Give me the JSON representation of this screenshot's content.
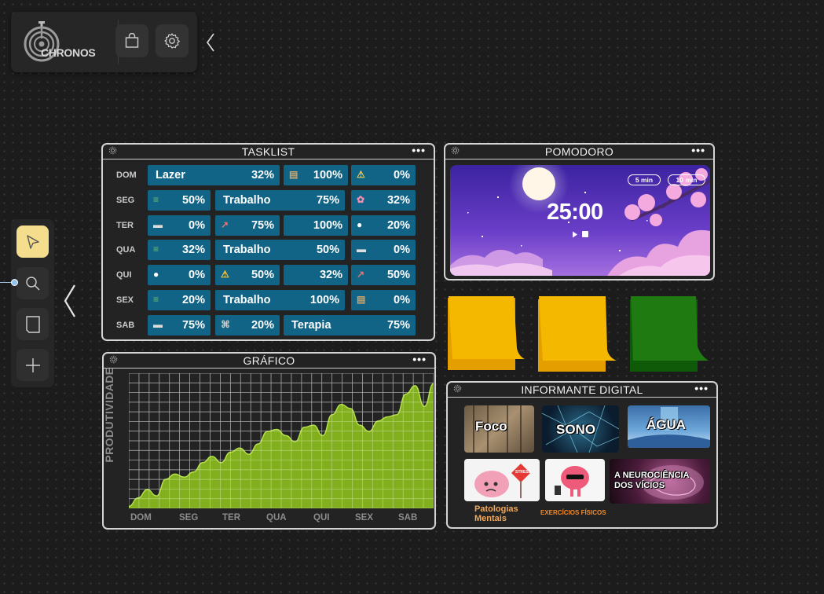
{
  "toolbar": {
    "logo_text": "CHRONOS",
    "shop_icon": "shopping-bag-icon",
    "settings_icon": "gear-icon",
    "collapse_icon": "chevron-left-icon"
  },
  "rail": {
    "tools": [
      "select-arrow-icon",
      "search-icon",
      "note-icon",
      "plus-icon"
    ],
    "collapse_icon": "chevron-left-icon"
  },
  "tasklist": {
    "title": "TASKLIST",
    "menu": "•••",
    "days": [
      "DOM",
      "SEG",
      "TER",
      "QUA",
      "QUI",
      "SEX",
      "SAB"
    ],
    "rows": [
      [
        {
          "label": "Lazer",
          "pct": "32%"
        },
        {
          "icon": "scroll-icon",
          "pct": "100%"
        },
        {
          "icon": "warning-icon",
          "pct": "0%"
        }
      ],
      [
        {
          "icon": "books-icon",
          "pct": "50%"
        },
        {
          "label": "Trabalho",
          "pct": "75%"
        },
        {
          "icon": "flower-icon",
          "pct": "32%"
        }
      ],
      [
        {
          "icon": "laptop-icon",
          "pct": "0%"
        },
        {
          "icon": "chart-icon",
          "pct": "75%"
        },
        {
          "label": "",
          "pct": "100%"
        },
        {
          "icon": "soccer-ball-icon",
          "pct": "20%"
        }
      ],
      [
        {
          "icon": "books-icon",
          "pct": "32%"
        },
        {
          "label": "Trabalho",
          "pct": "50%"
        },
        {
          "icon": "laptop-icon",
          "pct": "0%"
        }
      ],
      [
        {
          "icon": "soccer-ball-icon",
          "pct": "0%"
        },
        {
          "icon": "warning-icon",
          "pct": "50%"
        },
        {
          "label": "",
          "pct": "32%"
        },
        {
          "icon": "chart-icon",
          "pct": "50%"
        }
      ],
      [
        {
          "icon": "books-icon",
          "pct": "20%"
        },
        {
          "label": "Trabalho",
          "pct": "100%"
        },
        {
          "icon": "scroll-icon",
          "pct": "0%"
        }
      ],
      [
        {
          "icon": "laptop-icon",
          "pct": "75%"
        },
        {
          "icon": "gamepad-icon",
          "pct": "20%"
        },
        {
          "label": "Terapia",
          "pct": "75%"
        }
      ]
    ],
    "accent": "#116486"
  },
  "pomodoro": {
    "title": "POMODORO",
    "menu": "•••",
    "timer": "25:00",
    "options": [
      "5 min",
      "10 min"
    ],
    "controls": [
      "play-icon",
      "stop-icon"
    ]
  },
  "notes": {
    "colors": [
      "#f5b800",
      "#f5b800",
      "#1f7a12"
    ]
  },
  "grafico": {
    "title": "GRÁFICO",
    "menu": "•••"
  },
  "chart_data": {
    "type": "area",
    "title": "GRÁFICO",
    "xlabel": "",
    "ylabel": "PRODUTIVIDADE",
    "categories": [
      "DOM",
      "SEG",
      "TER",
      "QUA",
      "QUI",
      "SEX",
      "SAB"
    ],
    "x": [
      0,
      0.2,
      0.4,
      0.6,
      0.8,
      1.0,
      1.2,
      1.4,
      1.6,
      1.8,
      2.0,
      2.2,
      2.4,
      2.6,
      2.8,
      3.0,
      3.2,
      3.4,
      3.6,
      3.8,
      4.0,
      4.2,
      4.4,
      4.6,
      4.8,
      5.0,
      5.2,
      5.4,
      5.6,
      5.8,
      6.0,
      6.2,
      6.4,
      6.6
    ],
    "series": [
      {
        "values": [
          2,
          10,
          18,
          12,
          28,
          33,
          30,
          35,
          44,
          50,
          44,
          54,
          58,
          52,
          62,
          74,
          76,
          70,
          64,
          78,
          80,
          70,
          90,
          100,
          96,
          80,
          74,
          84,
          88,
          90,
          110,
          118,
          98,
          120
        ]
      }
    ],
    "ylim": [
      0,
      130
    ],
    "grid": true,
    "color": "#8dbf1e"
  },
  "informante": {
    "title": "INFORMANTE DIGITAL",
    "menu": "•••",
    "cards": [
      {
        "label": "Foco"
      },
      {
        "label": "SONO"
      },
      {
        "label": "ÁGUA"
      },
      {
        "label": "STRESS"
      },
      {
        "label": ""
      },
      {
        "label": "A  NEUROCIÊNCIA DOS VÍCIOS"
      }
    ],
    "captions": [
      "Patologias Mentais",
      "EXERCÍCIOS FÍSICOS"
    ]
  }
}
